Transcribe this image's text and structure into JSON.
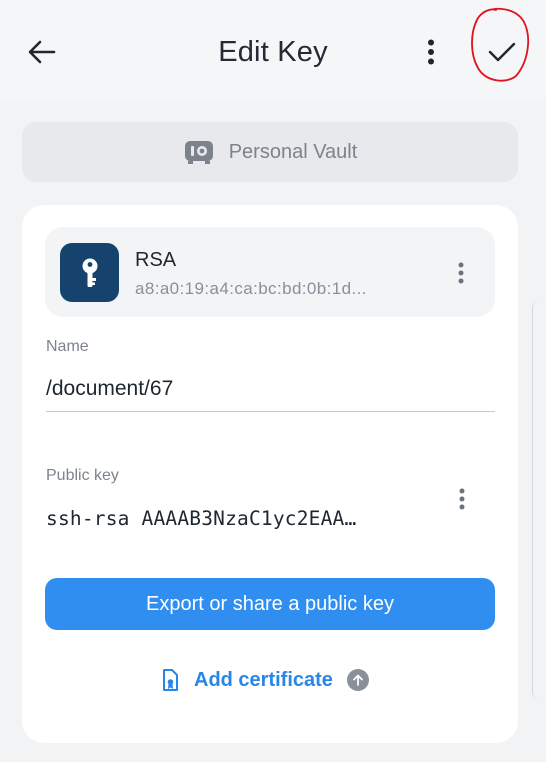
{
  "header": {
    "title": "Edit Key",
    "back_icon": "arrow-left-icon",
    "more_icon": "more-vertical-icon",
    "confirm_icon": "check-icon"
  },
  "vault": {
    "label": "Personal Vault",
    "icon": "vault-safe-icon"
  },
  "key": {
    "type": "RSA",
    "fingerprint": "a8:a0:19:a4:ca:bc:bd:0b:1d...",
    "icon": "key-icon",
    "icon_bg": "#16436e"
  },
  "fields": {
    "name_label": "Name",
    "name_value": "/document/67",
    "public_key_label": "Public key",
    "public_key_value": "ssh-rsa AAAAB3NzaC1yc2EAA…"
  },
  "actions": {
    "export_label": "Export or share a public key",
    "add_certificate_label": "Add certificate"
  },
  "colors": {
    "accent": "#2f8ef0",
    "link": "#2a86e6",
    "annotation": "#e0141e"
  }
}
